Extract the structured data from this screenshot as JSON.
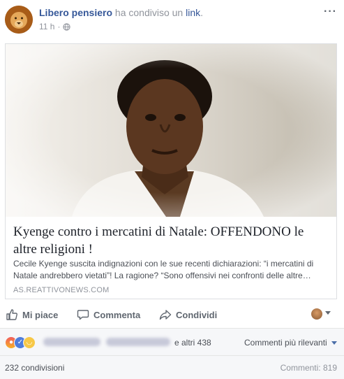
{
  "post": {
    "author": "Libero pensiero",
    "action_text": "ha condiviso un",
    "link_word": "link",
    "period": ".",
    "time": "11 h",
    "separator": "·",
    "more": "···"
  },
  "link_card": {
    "title": "Kyenge contro i mercatini di Natale: OFFENDONO le altre religioni !",
    "description": "Cecile Kyenge suscita indignazioni con le sue recenti dichiarazioni: “i mercatini di Natale andrebbero vietati”! La ragione? “Sono offensivi nei confronti delle altre…",
    "domain": "AS.REATTIVONEWS.COM"
  },
  "actions": {
    "like": "Mi piace",
    "comment": "Commenta",
    "share": "Condividi"
  },
  "reactions": {
    "others": "e altri 438",
    "sort": "Commenti più rilevanti"
  },
  "footer": {
    "shares": "232 condivisioni",
    "comments": "Commenti: 819"
  },
  "colors": {
    "link_blue": "#365899",
    "meta_gray": "#90949c",
    "action_gray": "#606770",
    "bar_bg": "#f6f7f9"
  },
  "icons": [
    "lion-avatar",
    "globe-icon",
    "more-icon",
    "like-icon",
    "comment-icon",
    "share-icon",
    "viewer-avatar",
    "angry-reaction-icon",
    "like-reaction-icon",
    "haha-reaction-icon"
  ]
}
